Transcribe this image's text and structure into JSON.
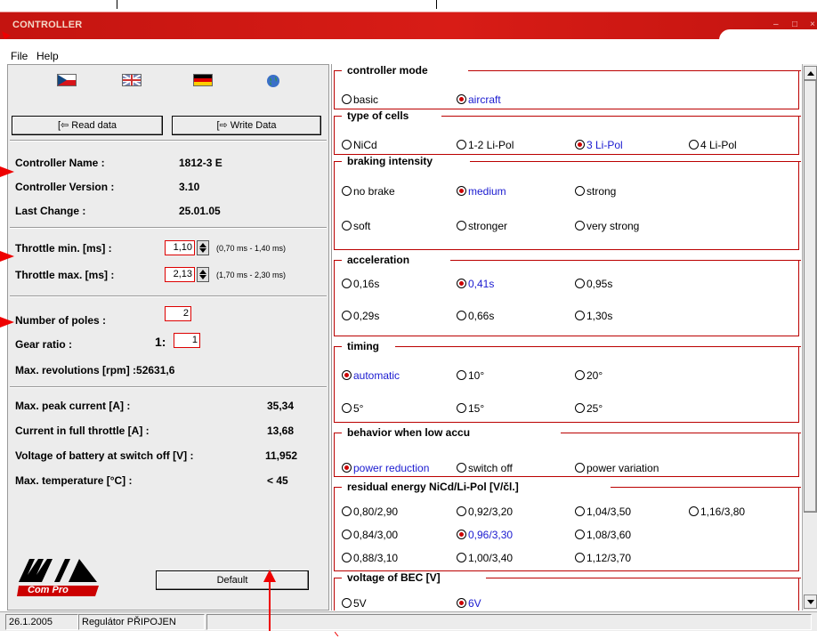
{
  "window": {
    "title": "CONTROLLER"
  },
  "menu": [
    "File",
    "Help"
  ],
  "flags": [
    "czech-flag",
    "uk-flag",
    "german-flag",
    "globe-icon"
  ],
  "buttons": {
    "read": "Read data",
    "write": "Write Data",
    "default": "Default"
  },
  "info": {
    "name_label": "Controller Name :",
    "name_value": "1812-3 E",
    "version_label": "Controller Version :",
    "version_value": "3.10",
    "change_label": "Last Change :",
    "change_value": "25.01.05"
  },
  "throttle": {
    "min_label": "Throttle min. [ms] :",
    "min_value": "1,10",
    "min_range": "(0,70 ms - 1,40 ms)",
    "max_label": "Throttle max. [ms] :",
    "max_value": "2,13",
    "max_range": "(1,70 ms - 2,30 ms)"
  },
  "motor": {
    "poles_label": "Number of poles :",
    "poles_value": "2",
    "gear_label": "Gear ratio :",
    "gear_prefix": "1:",
    "gear_value": "1",
    "rpm_label": "Max. revolutions [rpm] :52631,6"
  },
  "stats": {
    "peak_label": "Max. peak current [A] :",
    "peak_value": "35,34",
    "full_label": "Current in full throttle [A] :",
    "full_value": "13,68",
    "volt_label": "Voltage of battery at switch off [V] :",
    "volt_value": "11,952",
    "temp_label": "Max. temperature [°C] :",
    "temp_value": "< 45"
  },
  "logo": {
    "text": "Com Pro"
  },
  "groups": {
    "mode": {
      "title": "controller mode",
      "opts": [
        "basic",
        "aircraft"
      ]
    },
    "cells": {
      "title": "type of cells",
      "opts": [
        "NiCd",
        "1-2 Li-Pol",
        "3 Li-Pol",
        "4 Li-Pol"
      ]
    },
    "braking": {
      "title": "braking intensity",
      "opts": [
        "no brake",
        "medium",
        "strong",
        "soft",
        "stronger",
        "very strong"
      ]
    },
    "accel": {
      "title": "acceleration",
      "opts": [
        "0,16s",
        "0,41s",
        "0,95s",
        "0,29s",
        "0,66s",
        "1,30s"
      ]
    },
    "timing": {
      "title": "timing",
      "opts": [
        "automatic",
        "10°",
        "20°",
        "5°",
        "15°",
        "25°"
      ]
    },
    "lowaccu": {
      "title": "behavior when low accu",
      "opts": [
        "power reduction",
        "switch off",
        "power variation"
      ]
    },
    "residual": {
      "title": "residual energy NiCd/Li-Pol [V/čl.]",
      "opts": [
        "0,80/2,90",
        "0,92/3,20",
        "1,04/3,50",
        "1,16/3,80",
        "0,84/3,00",
        "0,96/3,30",
        "1,08/3,60",
        "0,88/3,10",
        "1,00/3,40",
        "1,12/3,70"
      ]
    },
    "bec": {
      "title": "voltage of BEC [V]",
      "opts": [
        "5V",
        "6V"
      ]
    }
  },
  "status": {
    "date": "26.1.2005",
    "conn": "Regulátor PŘIPOJEN"
  },
  "colors": {
    "titlebar": "#d81c16",
    "accent": "#cc0000",
    "selected_text": "#1a1ad0"
  }
}
